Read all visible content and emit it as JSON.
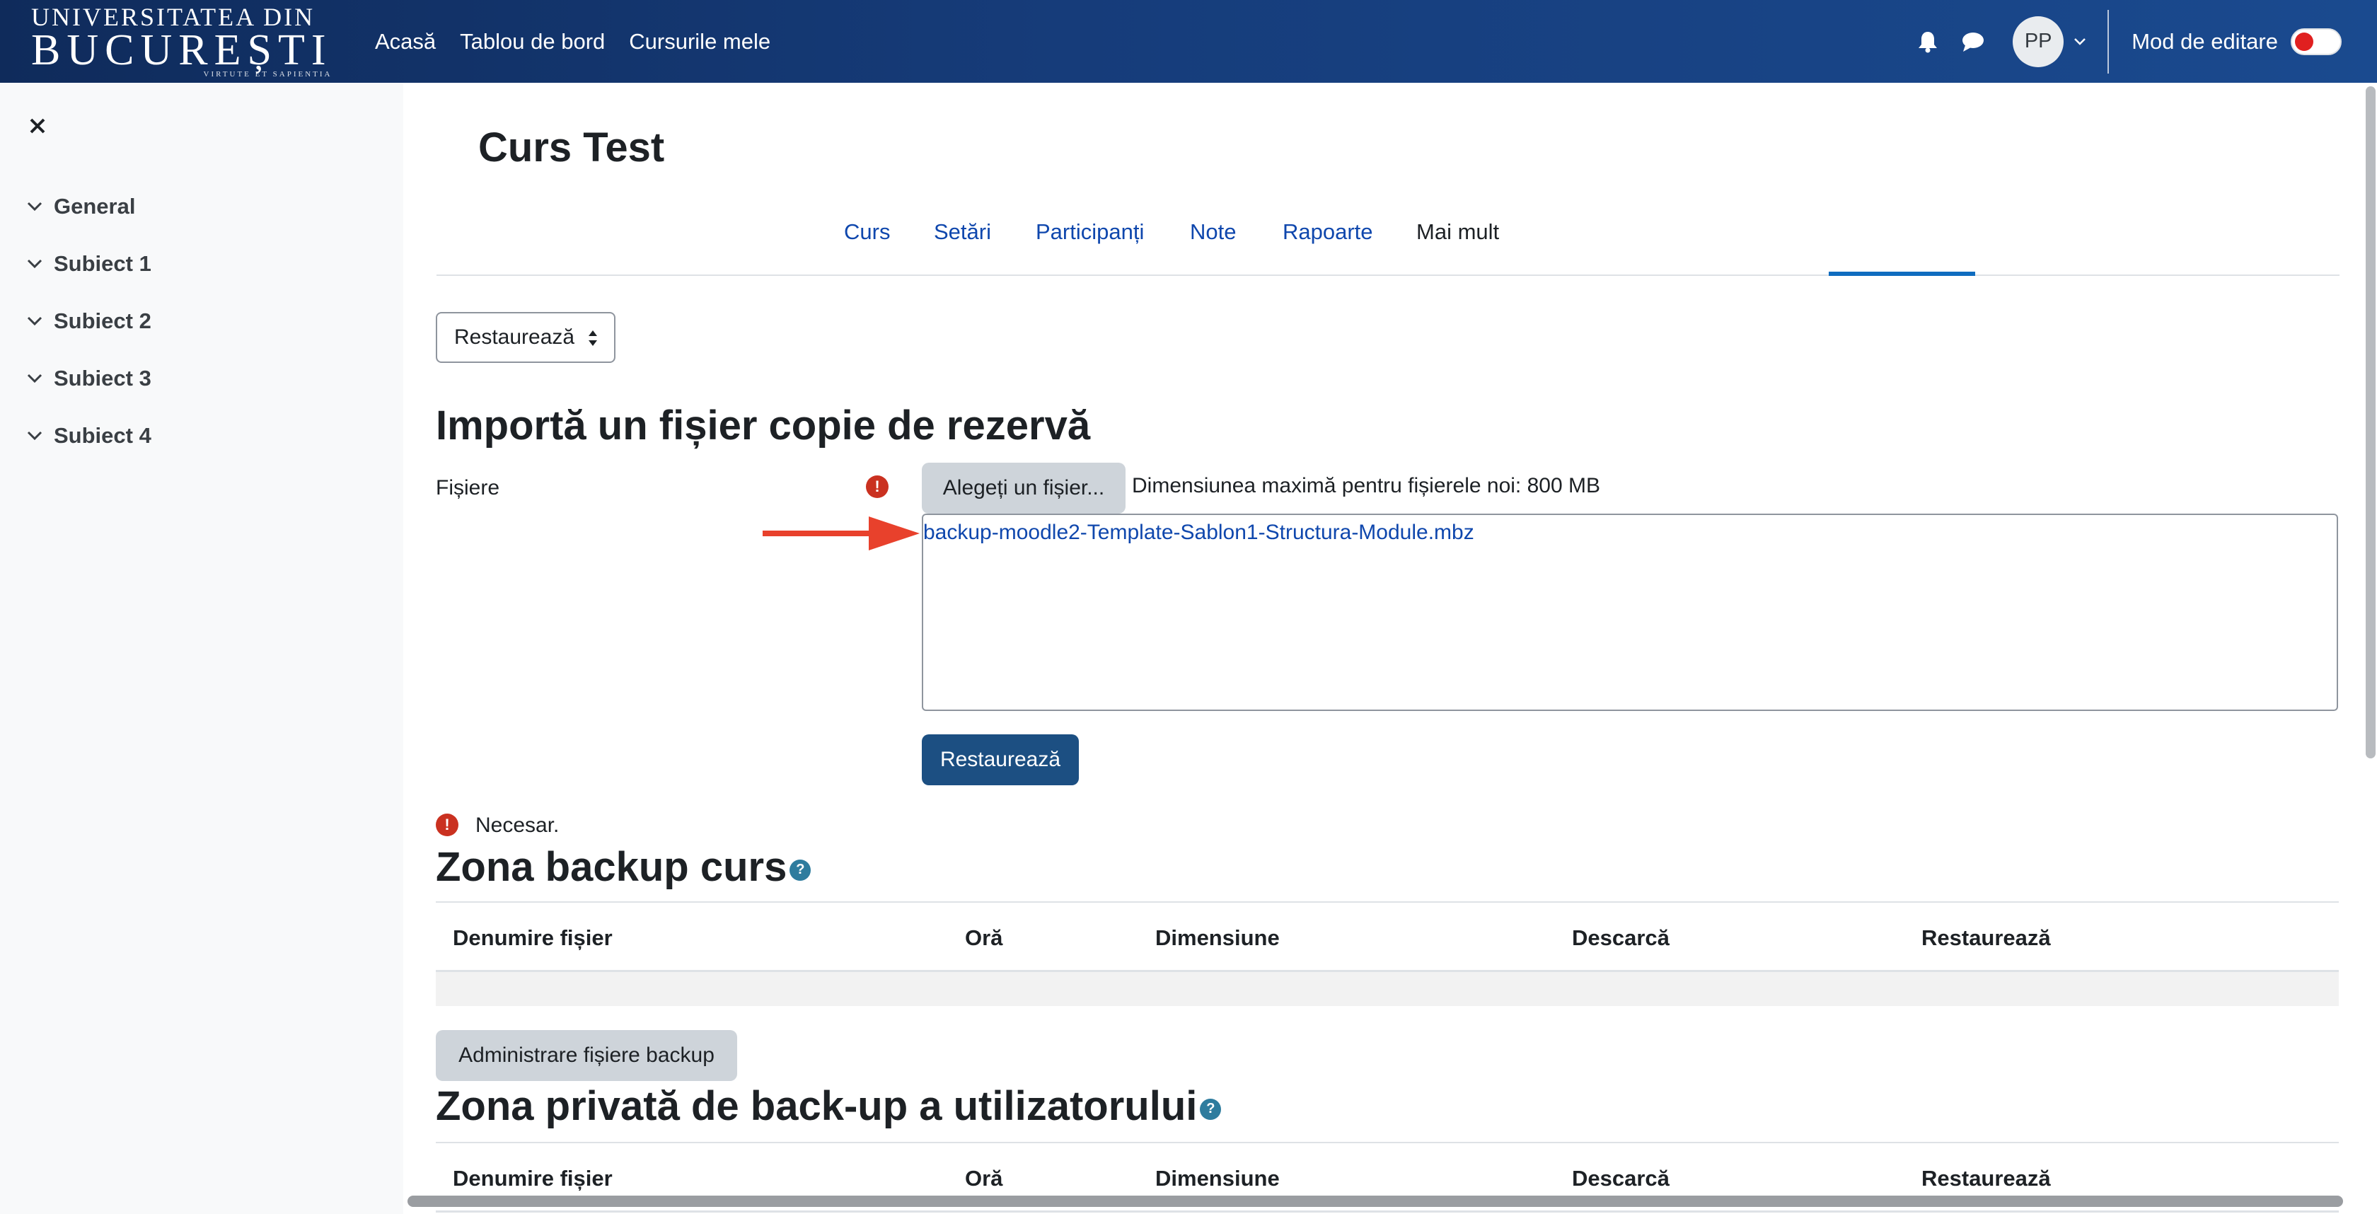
{
  "navbar": {
    "logo": {
      "line1": "UNIVERSITATEA DIN",
      "line2": "BUCUREȘTI",
      "line3": "VIRTUTE ET SAPIENTIA"
    },
    "links": [
      "Acasă",
      "Tablou de bord",
      "Cursurile mele"
    ],
    "avatar_initials": "PP",
    "edit_mode_label": "Mod de editare",
    "edit_mode_on": false,
    "icons": [
      "bell-icon",
      "chat-icon",
      "chevron-down-icon"
    ]
  },
  "drawer": {
    "items": [
      "General",
      "Subiect 1",
      "Subiect 2",
      "Subiect 3",
      "Subiect 4"
    ]
  },
  "course": {
    "title": "Curs Test",
    "tabs": [
      {
        "label": "Curs",
        "active": false
      },
      {
        "label": "Setări",
        "active": false
      },
      {
        "label": "Participanți",
        "active": false
      },
      {
        "label": "Note",
        "active": false
      },
      {
        "label": "Rapoarte",
        "active": false
      },
      {
        "label": "Mai mult",
        "active": true
      }
    ]
  },
  "action_select": {
    "value": "Restaurează"
  },
  "import": {
    "heading": "Importă un fișier copie de rezervă",
    "files_label": "Fișiere",
    "required_icon": "!",
    "choose_button": "Alegeți un fișier...",
    "max_size": "Dimensiunea maximă pentru fișierele noi: 800 MB",
    "file_name": "backup-moodle2-Template-Sablon1-Structura-Module.mbz",
    "restore_button": "Restaurează",
    "required_note": "Necesar."
  },
  "course_backup": {
    "heading": "Zona backup curs",
    "help_icon": "?",
    "columns": [
      "Denumire fișier",
      "Oră",
      "Dimensiune",
      "Descarcă",
      "Restaurează"
    ],
    "rows": [],
    "manage_button": "Administrare fișiere backup"
  },
  "user_backup": {
    "heading": "Zona privată de back-up a utilizatorului",
    "help_icon": "?",
    "columns": [
      "Denumire fișier",
      "Oră",
      "Dimensiune",
      "Descarcă",
      "Restaurează"
    ]
  },
  "colors": {
    "navbar": "#163c7a",
    "link": "#0f47ad",
    "primary_button": "#1c4f82",
    "required": "#ca3120",
    "arrow": "#e8412c",
    "toggle_off": "#e02020"
  }
}
